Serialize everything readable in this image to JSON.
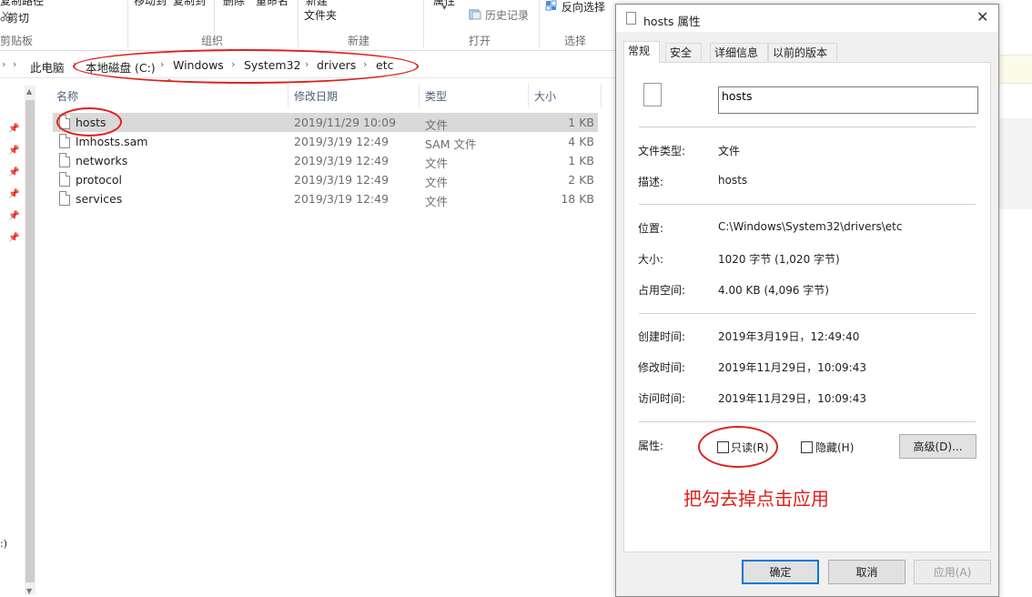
{
  "ribbon": {
    "top_labels": {
      "copy_path_partial": "复制路径",
      "move_to_partial": "移动到",
      "copy_to_partial": "复制到",
      "delete_partial": "删除",
      "rename_partial": "重命名",
      "new_folder_line1": "新建",
      "new_folder_line2": "文件夹",
      "properties_partial": "属性",
      "history": "历史记录",
      "invert_selection": "反向选择",
      "cut": "剪切"
    },
    "groups": {
      "clipboard": "剪贴板",
      "organize": "组织",
      "new": "新建",
      "open": "打开",
      "select": "选择"
    }
  },
  "address_bar": {
    "crumbs": [
      "此电脑",
      "本地磁盘 (C:)",
      "Windows",
      "System32",
      "drivers",
      "etc"
    ]
  },
  "file_list": {
    "columns": {
      "name": "名称",
      "modified": "修改日期",
      "type": "类型",
      "size": "大小"
    },
    "rows": [
      {
        "name": "hosts",
        "modified": "2019/11/29 10:09",
        "type": "文件",
        "size": "1 KB",
        "selected": true
      },
      {
        "name": "lmhosts.sam",
        "modified": "2019/3/19 12:49",
        "type": "SAM 文件",
        "size": "4 KB"
      },
      {
        "name": "networks",
        "modified": "2019/3/19 12:49",
        "type": "文件",
        "size": "1 KB"
      },
      {
        "name": "protocol",
        "modified": "2019/3/19 12:49",
        "type": "文件",
        "size": "2 KB"
      },
      {
        "name": "services",
        "modified": "2019/3/19 12:49",
        "type": "文件",
        "size": "18 KB"
      }
    ]
  },
  "left_nav": {
    "drive_label_partial": ":)"
  },
  "dialog": {
    "title": "hosts 属性",
    "close_glyph": "✕",
    "tabs": [
      "常规",
      "安全",
      "详细信息",
      "以前的版本"
    ],
    "file_name": "hosts",
    "fields": {
      "file_type_label": "文件类型:",
      "file_type_value": "文件",
      "description_label": "描述:",
      "description_value": "hosts",
      "location_label": "位置:",
      "location_value": "C:\\Windows\\System32\\drivers\\etc",
      "size_label": "大小:",
      "size_value": "1020 字节 (1,020 字节)",
      "size_on_disk_label": "占用空间:",
      "size_on_disk_value": "4.00 KB (4,096 字节)",
      "created_label": "创建时间:",
      "created_value": "2019年3月19日，12:49:40",
      "modified_label": "修改时间:",
      "modified_value": "2019年11月29日，10:09:43",
      "accessed_label": "访问时间:",
      "accessed_value": "2019年11月29日，10:09:43",
      "attributes_label": "属性:"
    },
    "attributes": {
      "readonly_label": "只读(R)",
      "readonly_checked": false,
      "hidden_label": "隐藏(H)",
      "hidden_checked": false,
      "advanced_button": "高级(D)..."
    },
    "annotation_text": "把勾去掉点击应用",
    "buttons": {
      "ok": "确定",
      "cancel": "取消",
      "apply": "应用(A)"
    }
  },
  "colors": {
    "annotation_red": "#e0201b",
    "primary_button_border": "#0078d7",
    "selected_row": "#d9d9d9"
  }
}
